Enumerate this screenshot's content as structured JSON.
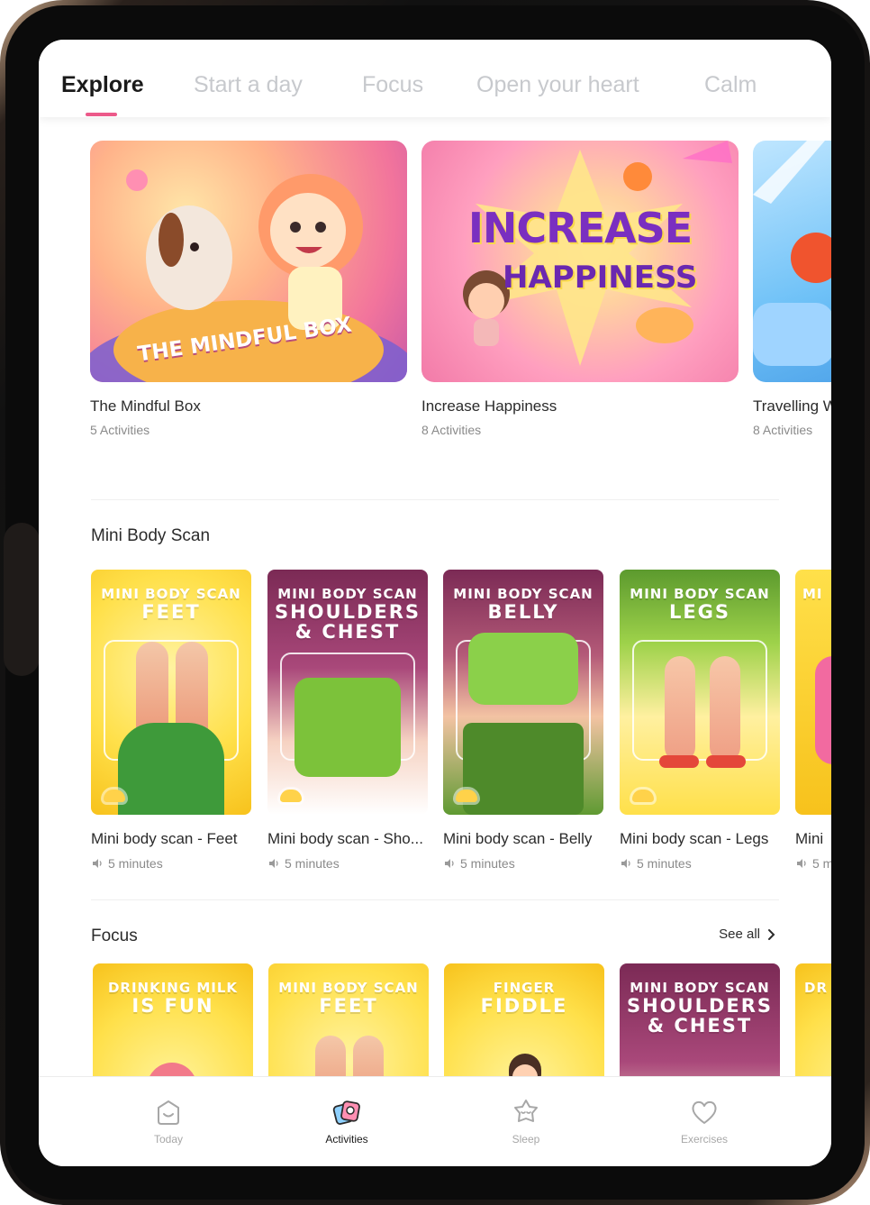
{
  "top_tabs": [
    "Explore",
    "Start a day",
    "Focus",
    "Open your heart",
    "Calm"
  ],
  "collections": [
    {
      "title": "The Mindful Box",
      "subtitle": "5 Activities",
      "art_text": "THE MINDFUL BOX"
    },
    {
      "title": "Increase Happiness",
      "subtitle": "8 Activities",
      "art_line1": "INCREASE",
      "art_line2": "HAPPINESS"
    },
    {
      "title": "Travelling W",
      "subtitle": "8 Activities"
    }
  ],
  "sections": {
    "body_scan": {
      "title": "Mini Body Scan",
      "cards": [
        {
          "title": "Mini body scan - Feet",
          "meta": "5 minutes",
          "art_small": "MINI BODY SCAN",
          "art_big": "FEET"
        },
        {
          "title": "Mini body scan - Sho...",
          "meta": "5 minutes",
          "art_small": "MINI BODY SCAN",
          "art_big": "SHOULDERS",
          "art_big2": "& CHEST"
        },
        {
          "title": "Mini body scan - Belly",
          "meta": "5 minutes",
          "art_small": "MINI BODY SCAN",
          "art_big": "BELLY"
        },
        {
          "title": "Mini body scan - Legs",
          "meta": "5 minutes",
          "art_small": "MINI BODY SCAN",
          "art_big": "LEGS"
        },
        {
          "title": "Mini",
          "meta": "5 m",
          "art_small": "MI"
        }
      ]
    },
    "focus": {
      "title": "Focus",
      "see_all": "See all",
      "cards": [
        {
          "art_small": "DRINKING MILK",
          "art_big": "IS FUN"
        },
        {
          "art_small": "MINI BODY SCAN",
          "art_big": "FEET"
        },
        {
          "art_small": "FINGER",
          "art_big": "FIDDLE"
        },
        {
          "art_small": "MINI BODY SCAN",
          "art_big": "SHOULDERS",
          "art_big2": "& CHEST"
        },
        {
          "art_small": "DR"
        }
      ]
    }
  },
  "bottom_nav": [
    {
      "label": "Today",
      "icon": "face-box-icon"
    },
    {
      "label": "Activities",
      "icon": "activity-cards-icon"
    },
    {
      "label": "Sleep",
      "icon": "sleeping-star-icon"
    },
    {
      "label": "Exercises",
      "icon": "heart-icon"
    }
  ],
  "colors": {
    "accent": "#ec5a8a",
    "tab_inactive": "#c7c9cd",
    "card_yellow": "#ffd63a",
    "card_purple": "#7b2a55",
    "card_green": "#8bd04a"
  }
}
